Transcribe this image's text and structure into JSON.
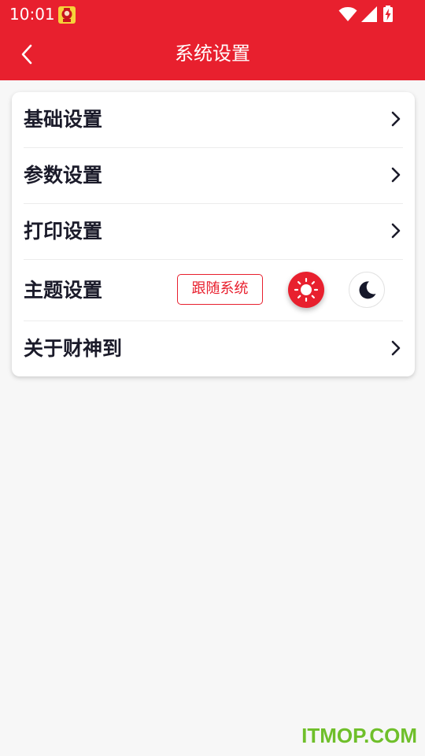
{
  "status_bar": {
    "time": "10:01",
    "icons": [
      "app-notification-icon",
      "wifi-icon",
      "signal-icon",
      "battery-charging-icon"
    ]
  },
  "header": {
    "title": "系统设置",
    "back_icon": "chevron-left-icon"
  },
  "settings": {
    "items": [
      {
        "label": "基础设置",
        "icon": "chevron-right-icon"
      },
      {
        "label": "参数设置",
        "icon": "chevron-right-icon"
      },
      {
        "label": "打印设置",
        "icon": "chevron-right-icon"
      },
      {
        "label": "主题设置"
      },
      {
        "label": "关于财神到",
        "icon": "chevron-right-icon"
      }
    ],
    "theme": {
      "follow_system_label": "跟随系统",
      "light_icon": "sun-icon",
      "dark_icon": "moon-icon",
      "selected": "light"
    }
  },
  "watermark": "ITMOP.COM",
  "colors": {
    "accent": "#e8202e",
    "background": "#f7f7f7",
    "card": "#ffffff",
    "text": "#1b1b2a",
    "watermark": "#6fbf2a"
  }
}
